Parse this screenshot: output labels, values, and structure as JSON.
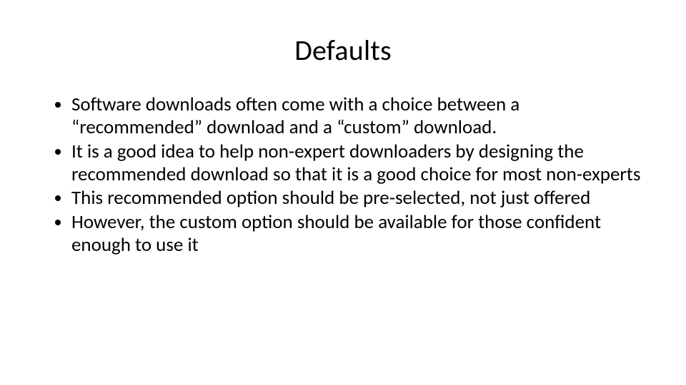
{
  "slide": {
    "title": "Defaults",
    "bullets": [
      "Software downloads often come with a choice between a “recommended” download and a “custom” download.",
      "It is a good idea to help non-expert downloaders by designing the recommended download so that it is a good choice for most non-experts",
      "This recommended option should be pre-selected, not just offered",
      "However, the custom option should be available for those confident enough to use it"
    ]
  }
}
